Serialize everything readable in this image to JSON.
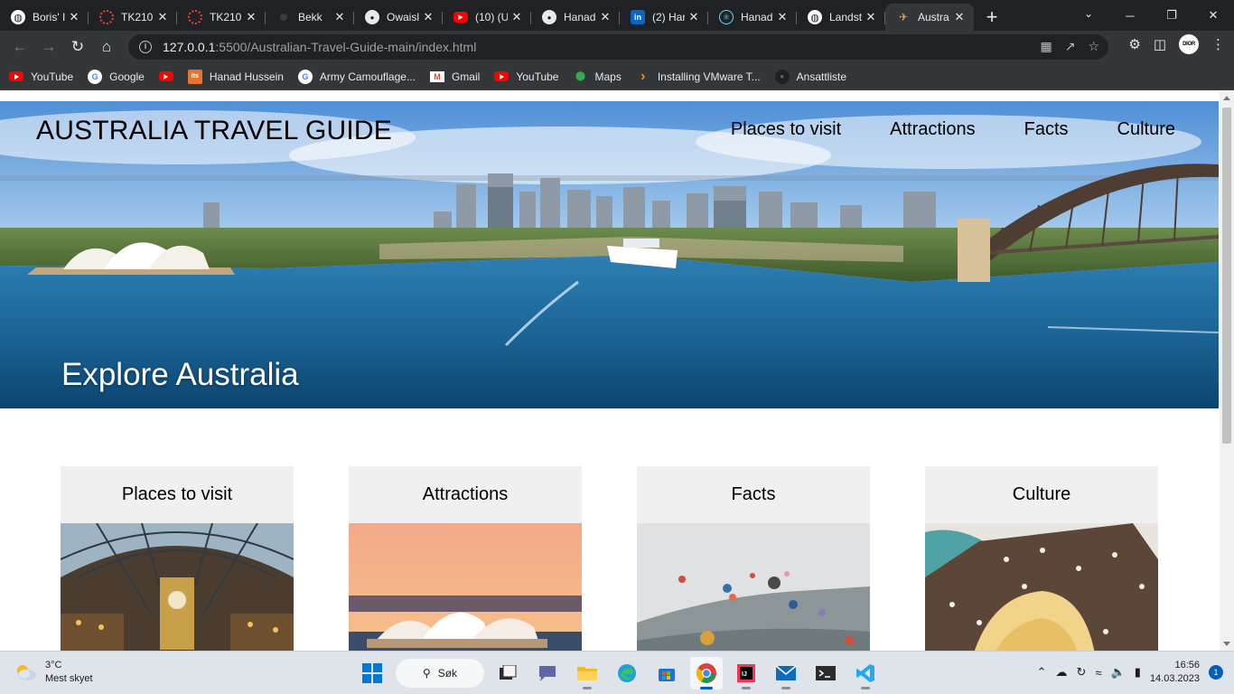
{
  "browser": {
    "tabs": [
      {
        "title": "Boris' I",
        "icon": "globe-icon",
        "color": "#ffffff",
        "active": false
      },
      {
        "title": "TK210(",
        "icon": "ring-icon",
        "color": "#e8453c",
        "active": false
      },
      {
        "title": "TK210(",
        "icon": "ring-icon",
        "color": "#e8453c",
        "active": false
      },
      {
        "title": "Bekk",
        "icon": "dot-icon",
        "color": "#3c3d41",
        "active": false
      },
      {
        "title": "Owaisl",
        "icon": "github-icon",
        "color": "#e8eaed",
        "active": false
      },
      {
        "title": "(10) (U",
        "icon": "youtube-icon",
        "color": "#ff0000",
        "active": false
      },
      {
        "title": "Hanad",
        "icon": "github-icon",
        "color": "#e8eaed",
        "active": false
      },
      {
        "title": "(2) Har",
        "icon": "linkedin-icon",
        "color": "#0a66c2",
        "active": false
      },
      {
        "title": "Hanad",
        "icon": "react-icon",
        "color": "#61dafb",
        "active": false
      },
      {
        "title": "Landst",
        "icon": "globe-icon",
        "color": "#ffffff",
        "active": false
      },
      {
        "title": "Austra",
        "icon": "plane-icon",
        "color": "#d4a657",
        "active": true
      }
    ],
    "new_tab_label": "+",
    "url_host": "127.0.0.1",
    "url_path": ":5500/Australian-Travel-Guide-main/index.html",
    "profile_label": "DIOR",
    "bookmarks": [
      {
        "label": "YouTube",
        "icon": "youtube-icon"
      },
      {
        "label": "Google",
        "icon": "google-icon"
      },
      {
        "label": "",
        "icon": "youtube-icon"
      },
      {
        "label": "Hanad Hussein",
        "icon": "its-icon"
      },
      {
        "label": "Army Camouflage...",
        "icon": "google-icon"
      },
      {
        "label": "Gmail",
        "icon": "gmail-icon"
      },
      {
        "label": "YouTube",
        "icon": "youtube-icon"
      },
      {
        "label": "Maps",
        "icon": "maps-icon"
      },
      {
        "label": "Installing VMware T...",
        "icon": "vmware-icon"
      },
      {
        "label": "Ansattliste",
        "icon": "ansatt-icon"
      }
    ]
  },
  "site": {
    "title": "AUSTRALIA TRAVEL GUIDE",
    "nav": [
      "Places to visit",
      "Attractions",
      "Facts",
      "Culture"
    ],
    "hero_caption": "Explore Australia",
    "cards": [
      {
        "title": "Places to visit"
      },
      {
        "title": "Attractions"
      },
      {
        "title": "Facts"
      },
      {
        "title": "Culture"
      }
    ]
  },
  "taskbar": {
    "weather_temp": "3°C",
    "weather_desc": "Mest skyet",
    "search_label": "Søk",
    "time": "16:56",
    "date": "14.03.2023",
    "notification_count": "1"
  }
}
